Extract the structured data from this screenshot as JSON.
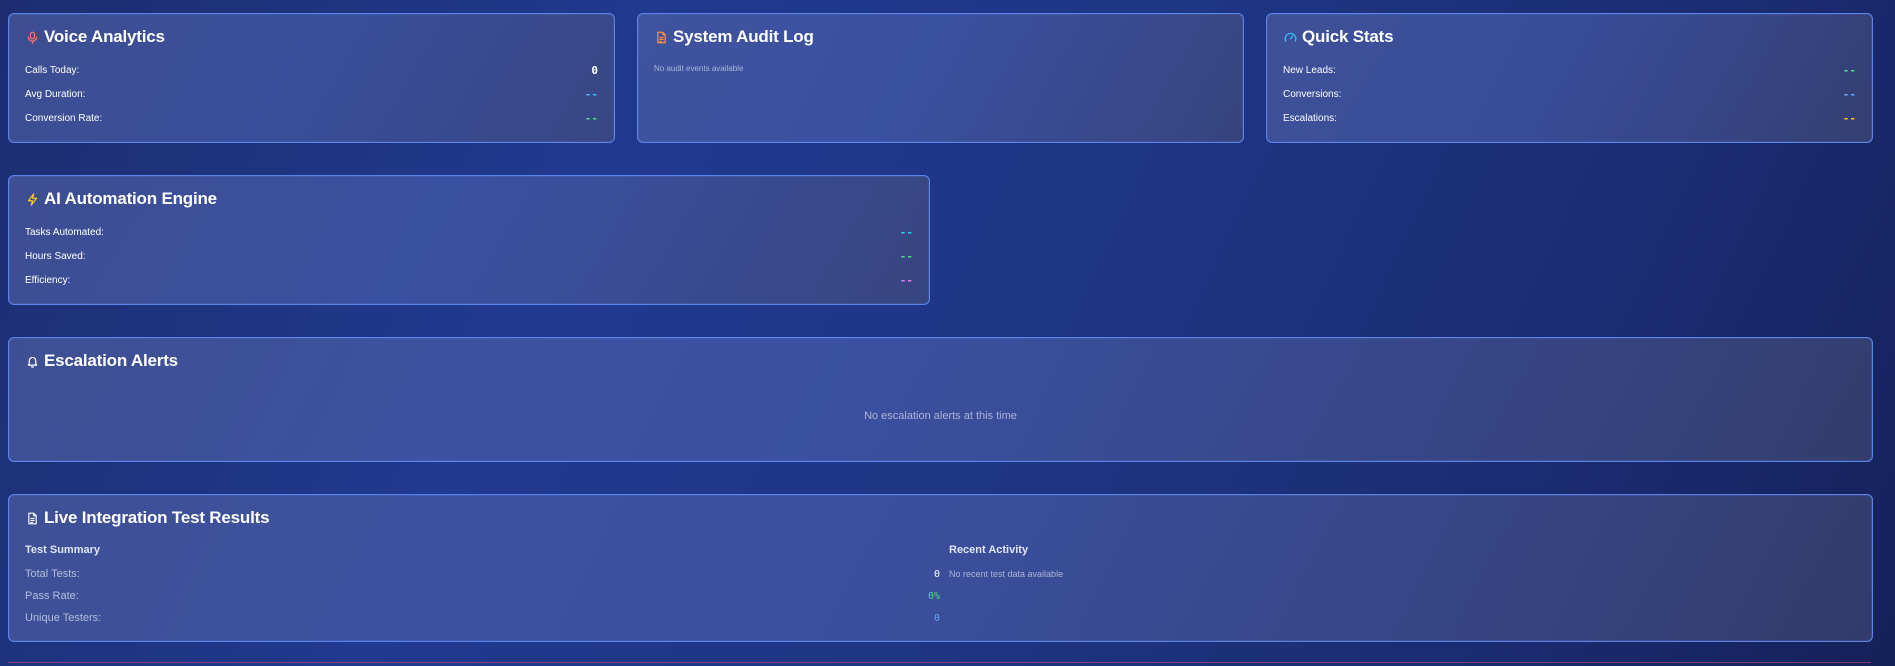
{
  "voice_analytics": {
    "title": "Voice Analytics",
    "rows": [
      {
        "label": "Calls Today:",
        "value": "0",
        "color": "#ffffff"
      },
      {
        "label": "Avg Duration:",
        "value": "--",
        "color": "#38bdf8"
      },
      {
        "label": "Conversion Rate:",
        "value": "--",
        "color": "#4ade80"
      }
    ]
  },
  "audit_log": {
    "title": "System Audit Log",
    "empty": "No audit events available"
  },
  "quick_stats": {
    "title": "Quick Stats",
    "rows": [
      {
        "label": "New Leads:",
        "value": "--",
        "color": "#4ade80"
      },
      {
        "label": "Conversions:",
        "value": "--",
        "color": "#60a5fa"
      },
      {
        "label": "Escalations:",
        "value": "--",
        "color": "#fbbf24"
      }
    ]
  },
  "automation": {
    "title": "AI Automation Engine",
    "rows": [
      {
        "label": "Tasks Automated:",
        "value": "--",
        "color": "#22d3ee"
      },
      {
        "label": "Hours Saved:",
        "value": "--",
        "color": "#4ade80"
      },
      {
        "label": "Efficiency:",
        "value": "--",
        "color": "#e879f9"
      }
    ]
  },
  "escalation": {
    "title": "Escalation Alerts",
    "empty": "No escalation alerts at this time"
  },
  "integration": {
    "title": "Live Integration Test Results",
    "summary_heading": "Test Summary",
    "activity_heading": "Recent Activity",
    "activity_empty": "No recent test data available",
    "rows": [
      {
        "label": "Total Tests:",
        "value": "0",
        "color": "#ffffff"
      },
      {
        "label": "Pass Rate:",
        "value": "0%",
        "color": "#4ade80"
      },
      {
        "label": "Unique Testers:",
        "value": "0",
        "color": "#60a5fa"
      }
    ]
  },
  "colors": {
    "mic_icon": "#f87171",
    "doc_icon": "#fb923c",
    "gauge_icon": "#38bdf8",
    "bolt_icon": "#facc15",
    "bell_icon": "#ffffff",
    "file_icon": "#ffffff"
  }
}
